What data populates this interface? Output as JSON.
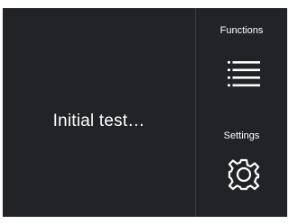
{
  "main": {
    "status_text": "Initial test…"
  },
  "sidebar": {
    "functions": {
      "label": "Functions",
      "icon": "list-menu-icon"
    },
    "settings": {
      "label": "Settings",
      "icon": "gear-icon"
    }
  },
  "colors": {
    "screen_background": "#222326",
    "divider": "#3a3b3f",
    "foreground": "#ffffff"
  }
}
